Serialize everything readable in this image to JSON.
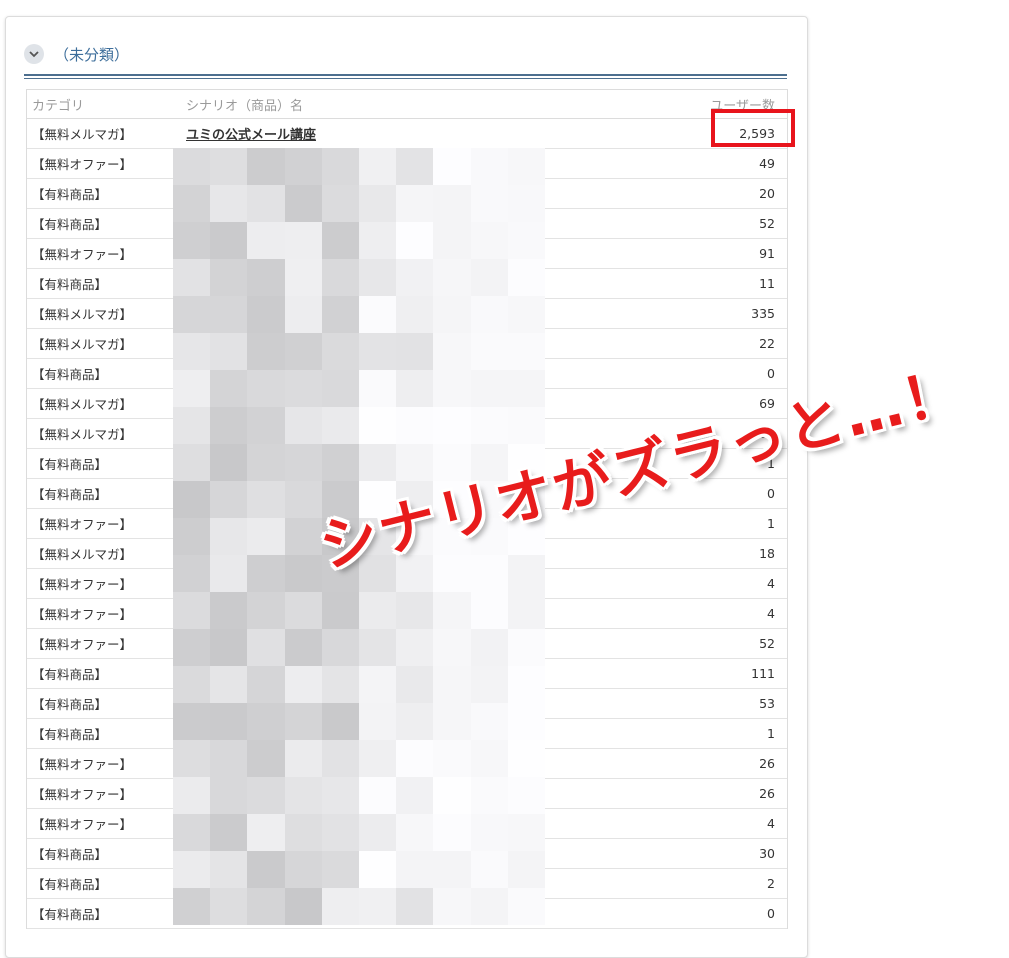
{
  "group": {
    "title": "（未分類）"
  },
  "table": {
    "headers": {
      "category": "カテゴリ",
      "scenario": "シナリオ（商品）名",
      "users": "ユーザー数"
    },
    "rows": [
      {
        "category": "【無料メルマガ】",
        "name": "ユミの公式メール講座",
        "users": "2,593"
      },
      {
        "category": "【無料オファー】",
        "name": "",
        "users": "49"
      },
      {
        "category": "【有料商品】",
        "name": "",
        "users": "20"
      },
      {
        "category": "【有料商品】",
        "name": "",
        "users": "52"
      },
      {
        "category": "【無料オファー】",
        "name": "",
        "users": "91"
      },
      {
        "category": "【有料商品】",
        "name": "",
        "users": "11"
      },
      {
        "category": "【無料メルマガ】",
        "name": "",
        "users": "335"
      },
      {
        "category": "【無料メルマガ】",
        "name": "",
        "users": "22"
      },
      {
        "category": "【有料商品】",
        "name": "",
        "users": "0"
      },
      {
        "category": "【無料メルマガ】",
        "name": "",
        "users": "69"
      },
      {
        "category": "【無料メルマガ】",
        "name": "",
        "users": "64"
      },
      {
        "category": "【有料商品】",
        "name": "",
        "users": "1"
      },
      {
        "category": "【有料商品】",
        "name": "",
        "users": "0"
      },
      {
        "category": "【無料オファー】",
        "name": "",
        "users": "1"
      },
      {
        "category": "【無料メルマガ】",
        "name": "",
        "users": "18"
      },
      {
        "category": "【無料オファー】",
        "name": "",
        "users": "4"
      },
      {
        "category": "【無料オファー】",
        "name": "",
        "users": "4"
      },
      {
        "category": "【無料オファー】",
        "name": "",
        "users": "52"
      },
      {
        "category": "【有料商品】",
        "name": "",
        "users": "111"
      },
      {
        "category": "【有料商品】",
        "name": "",
        "users": "53"
      },
      {
        "category": "【有料商品】",
        "name": "",
        "users": "1"
      },
      {
        "category": "【無料オファー】",
        "name": "",
        "users": "26"
      },
      {
        "category": "【無料オファー】",
        "name": "",
        "users": "26"
      },
      {
        "category": "【無料オファー】",
        "name": "",
        "users": "4"
      },
      {
        "category": "【有料商品】",
        "name": "",
        "users": "30"
      },
      {
        "category": "【有料商品】",
        "name": "",
        "users": "2"
      },
      {
        "category": "【有料商品】",
        "name": "",
        "users": "0"
      }
    ]
  },
  "annotation": {
    "text": "シナリオがズラっと…！",
    "color": "#e81c1c"
  },
  "colors": {
    "header_accent": "#3d6e9b",
    "highlight_border": "#e8141c"
  },
  "icons": {
    "toggle": "chevron-down-icon"
  }
}
